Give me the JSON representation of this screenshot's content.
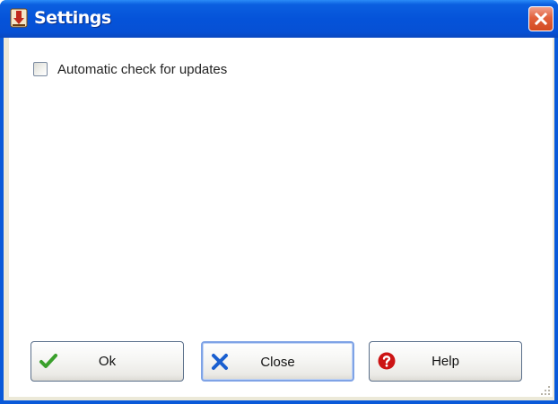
{
  "window": {
    "title": "Settings",
    "title_icon": "download-app-icon",
    "close_icon": "close-icon",
    "colors": {
      "titlebar": "#0553d9",
      "close_button": "#d24a22",
      "frame": "#0a5ad9"
    }
  },
  "settings": {
    "auto_update": {
      "label": "Automatic check for updates",
      "checked": false
    }
  },
  "buttons": {
    "ok": {
      "label": "Ok",
      "icon": "checkmark-icon",
      "color": "#3aa02c"
    },
    "close": {
      "label": "Close",
      "icon": "x-icon",
      "color": "#1a5fd0"
    },
    "help": {
      "label": "Help",
      "icon": "help-icon",
      "color": "#cc1414"
    }
  }
}
